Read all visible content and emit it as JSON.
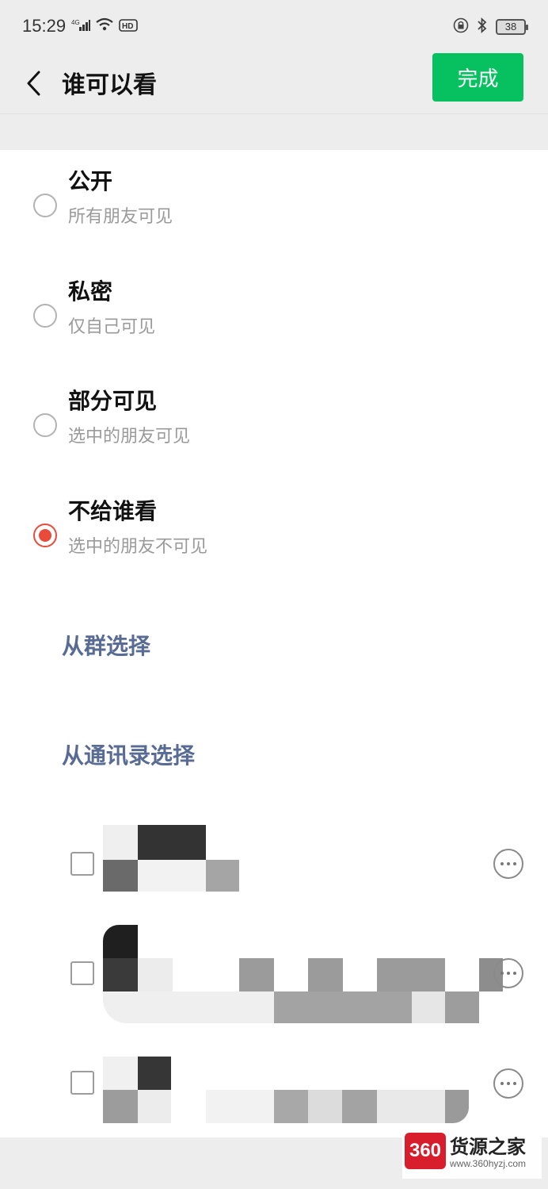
{
  "status_bar": {
    "time": "15:29",
    "network": "4G",
    "hd": "HD",
    "battery": "38",
    "icons": [
      "signal-icon",
      "wifi-icon",
      "hd-icon",
      "lock-icon",
      "bluetooth-icon",
      "battery-icon"
    ]
  },
  "nav": {
    "title": "谁可以看",
    "done_label": "完成"
  },
  "options": [
    {
      "title": "公开",
      "subtitle": "所有朋友可见",
      "selected": false
    },
    {
      "title": "私密",
      "subtitle": "仅自己可见",
      "selected": false
    },
    {
      "title": "部分可见",
      "subtitle": "选中的朋友可见",
      "selected": false
    },
    {
      "title": "不给谁看",
      "subtitle": "选中的朋友不可见",
      "selected": true
    }
  ],
  "links": {
    "from_group": "从群选择",
    "from_contacts": "从通讯录选择"
  },
  "contacts": [
    {
      "checked": false
    },
    {
      "checked": false
    },
    {
      "checked": false
    }
  ],
  "watermark": {
    "badge": "360",
    "title": "货源之家",
    "url": "www.360hyzj.com"
  },
  "colors": {
    "accent_green": "#07c160",
    "selected_red": "#e84b3a",
    "link_blue": "#576b95"
  }
}
